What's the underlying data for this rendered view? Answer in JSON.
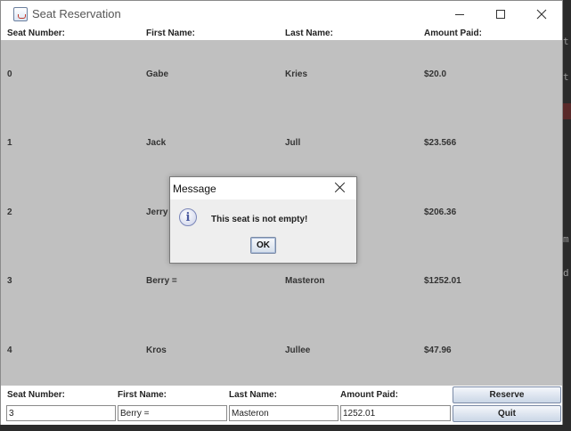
{
  "window": {
    "title": "Seat Reservation"
  },
  "background": {
    "chars": [
      "t",
      "t",
      "m",
      "d"
    ]
  },
  "table": {
    "headers": [
      "Seat Number:",
      "First Name:",
      "Last Name:",
      "Amount Paid:"
    ],
    "rows": [
      [
        "0",
        "Gabe",
        "Kries",
        "$20.0"
      ],
      [
        "1",
        "Jack",
        "Jull",
        "$23.566"
      ],
      [
        "2",
        "Jerry",
        "",
        "$206.36"
      ],
      [
        "3",
        "Berry =",
        "Masteron",
        "$1252.01"
      ],
      [
        "4",
        "Kros",
        "Jullee",
        "$47.96"
      ]
    ]
  },
  "form": {
    "labels": [
      "Seat Number:",
      "First Name:",
      "Last Name:",
      "Amount Paid:"
    ],
    "values": [
      "3",
      "Berry =",
      "Masteron",
      "1252.01"
    ]
  },
  "buttons": {
    "reserve": "Reserve",
    "quit": "Quit"
  },
  "dialog": {
    "title": "Message",
    "message": "This seat is not empty!",
    "ok": "OK",
    "icon": "i"
  }
}
